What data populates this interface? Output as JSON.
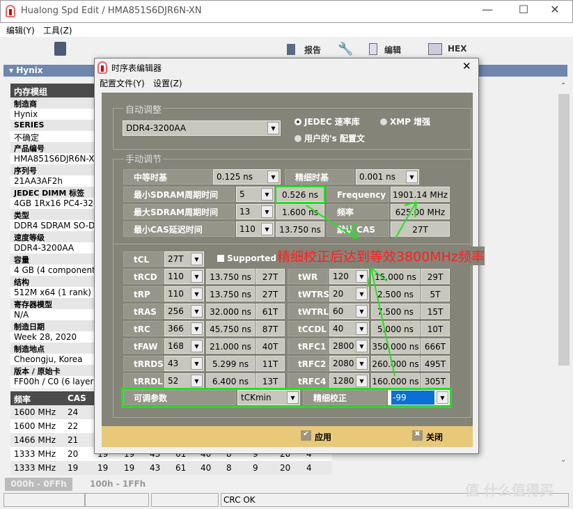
{
  "window": {
    "title": "Hualong Spd Edit / HMA851S6DJR6N-XN",
    "menus": [
      "编辑(Y)",
      "工具(Z)"
    ],
    "toolbar": {
      "report": "报告",
      "edit": "编辑",
      "hex": "HEX"
    }
  },
  "tree": {
    "group": "Hynix"
  },
  "props": {
    "header": "内存模组",
    "items": [
      {
        "label": "制造商",
        "value": "Hynix"
      },
      {
        "label": "SERIES",
        "value": "不确定"
      },
      {
        "label": "产品编号",
        "value": "HMA851S6DJR6N-XN"
      },
      {
        "label": "序列号",
        "value": "21AA3AF2h"
      },
      {
        "label": "JEDEC DIMM 标签",
        "value": "4GB 1Rx16 PC4-3200"
      },
      {
        "label": "类型",
        "value": "DDR4 SDRAM SO-DIMM"
      },
      {
        "label": "速度等级",
        "value": "DDR4-3200AA"
      },
      {
        "label": "容量",
        "value": "4 GB (4 components)"
      },
      {
        "label": "结构",
        "value": "512M x64 (1 rank)"
      },
      {
        "label": "寄存器模型",
        "value": "N/A"
      },
      {
        "label": "制造日期",
        "value": "Week 28, 2020"
      },
      {
        "label": "制造地点",
        "value": "Cheongju, Korea"
      },
      {
        "label": "版本 / 原始卡",
        "value": "FF00h / C0 (6 layers)"
      }
    ]
  },
  "freq_table": {
    "headers": [
      "频率",
      "CAS"
    ],
    "rows": [
      [
        "1600 MHz",
        "24"
      ],
      [
        "1600 MHz",
        "22"
      ],
      [
        "1466 MHz",
        "21"
      ],
      [
        "1333 MHz",
        "20",
        "19",
        "19",
        "43",
        "61",
        "40",
        "8",
        "9",
        "20",
        "4"
      ],
      [
        "1333 MHz",
        "19",
        "19",
        "19",
        "43",
        "61",
        "40",
        "8",
        "9",
        "20",
        "4"
      ]
    ]
  },
  "tabs": [
    "000h - 0FFh",
    "100h - 1FFh"
  ],
  "status": {
    "crc": "CRC OK"
  },
  "watermark": "值 什么值得买",
  "dialog": {
    "title": "时序表编辑器",
    "menus": [
      "配置文件(Y)",
      "设置(Z)"
    ],
    "auto": {
      "label": "自动调整",
      "profile": "DDR4-3200AA",
      "radio_jedec": "JEDEC 速率库",
      "radio_xmp": "XMP 增强",
      "radio_user": "用户的's 配置文"
    },
    "manual": {
      "label": "手动调节",
      "mtb_label": "中等时基",
      "mtb": "0.125 ns",
      "ftb_label": "精细时基",
      "ftb": "0.001 ns",
      "tckmin_label": "最小SDRAM周期时间",
      "tckmin": "5",
      "tckmin_ns": "0.526 ns",
      "freq_label": "Frequency",
      "freq": "1901.14 MHz",
      "tckmax_label": "最大SDRAM周期时间",
      "tckmax": "13",
      "tckmax_ns": "1.600 ns",
      "freq2_label": "频率",
      "freq2": "625.00 MHz",
      "taa_label": "最小CAS延迟时间",
      "taa": "110",
      "taa_ns": "13.750 ns",
      "cas_label": "默认 CAS",
      "cas": "27T",
      "tcl_label": "tCL",
      "tcl": "27T",
      "supported": "Supported",
      "left": [
        [
          "tRCD",
          "110",
          "13.750 ns",
          "27T"
        ],
        [
          "tRP",
          "110",
          "13.750 ns",
          "27T"
        ],
        [
          "tRAS",
          "256",
          "32.000 ns",
          "61T"
        ],
        [
          "tRC",
          "366",
          "45.750 ns",
          "87T"
        ],
        [
          "tFAW",
          "168",
          "21.000 ns",
          "40T"
        ],
        [
          "tRRDS",
          "43",
          "5.299 ns",
          "11T"
        ],
        [
          "tRRDL",
          "52",
          "6.400 ns",
          "13T"
        ]
      ],
      "right": [
        [
          "tWR",
          "120",
          "15.000 ns",
          "29T"
        ],
        [
          "tWTRS",
          "20",
          "2.500 ns",
          "5T"
        ],
        [
          "tWTRL",
          "60",
          "7.500 ns",
          "15T"
        ],
        [
          "tCCDL",
          "40",
          "5.000 ns",
          "10T"
        ],
        [
          "tRFC1",
          "2800",
          "350.000 ns",
          "666T"
        ],
        [
          "tRFC2",
          "2080",
          "260.000 ns",
          "495T"
        ],
        [
          "tRFC4",
          "1280",
          "160.000 ns",
          "305T"
        ]
      ],
      "adj_label": "可调参数",
      "adj": "tCKmin",
      "fine_label": "精细校正",
      "fine": "-99"
    },
    "apply": "应用",
    "close": "关闭"
  },
  "annotation": "精细校正后达到等效3800MHz频率",
  "colors": {
    "header_blue": "#6f87ae",
    "dialog_body": "#858478",
    "footer": "#e8c97a",
    "annotation": "#ff2020",
    "highlight": "#22e022"
  }
}
